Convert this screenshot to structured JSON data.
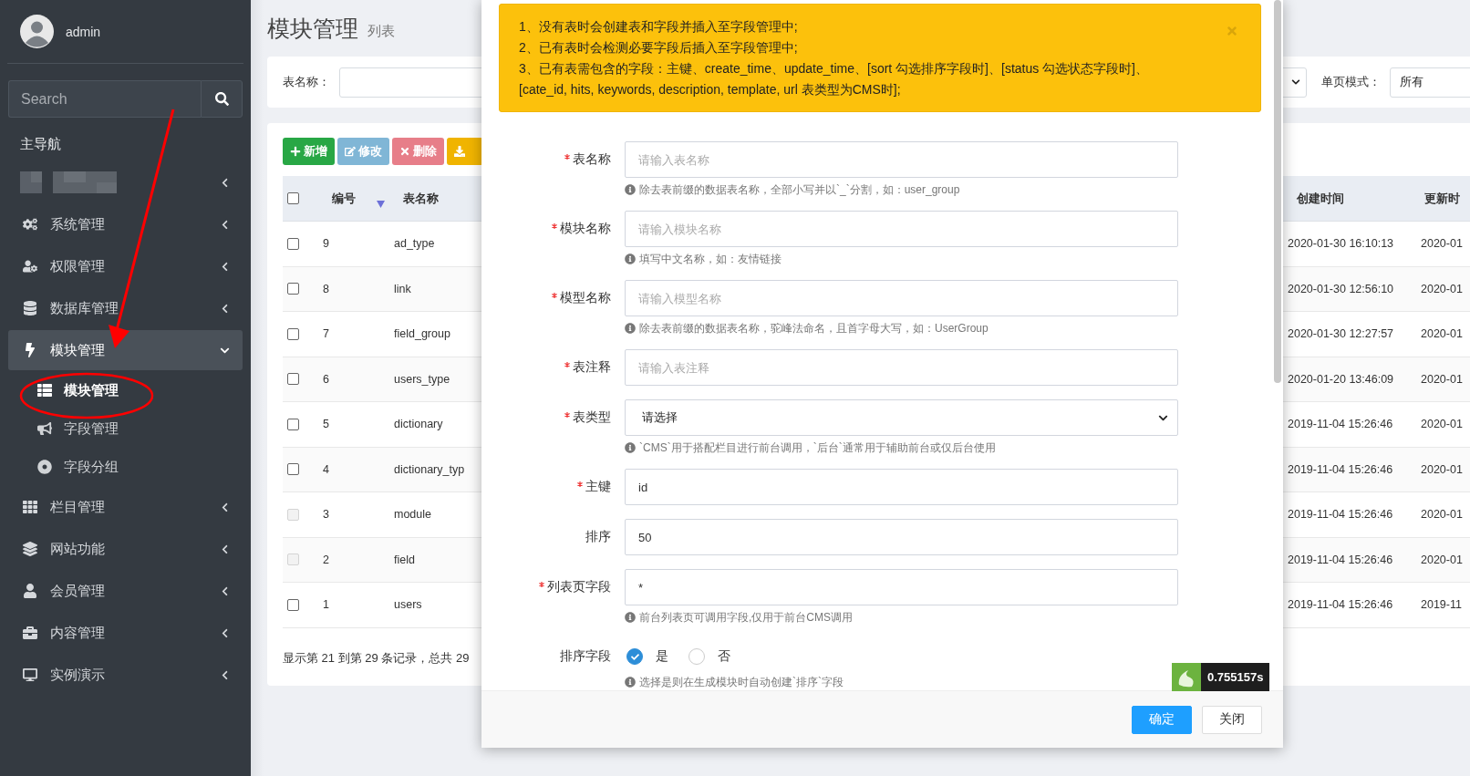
{
  "sidebar": {
    "user": {
      "name": "admin"
    },
    "search": {
      "placeholder": "Search"
    },
    "header": "主导航",
    "items": [
      {
        "kind": "blurred",
        "expanded": false,
        "selected": false
      },
      {
        "kind": "menu",
        "label": "系统管理",
        "expanded": false,
        "selected": false
      },
      {
        "kind": "menu",
        "label": "权限管理",
        "expanded": false,
        "selected": false
      },
      {
        "kind": "menu",
        "label": "数据库管理",
        "expanded": false,
        "selected": false
      },
      {
        "kind": "menu",
        "label": "模块管理",
        "expanded": true,
        "selected": true,
        "children": [
          {
            "label": "模块管理",
            "selected": true
          },
          {
            "label": "字段管理",
            "selected": false
          },
          {
            "label": "字段分组",
            "selected": false
          }
        ]
      },
      {
        "kind": "menu",
        "label": "栏目管理",
        "expanded": false,
        "selected": false
      },
      {
        "kind": "menu",
        "label": "网站功能",
        "expanded": false,
        "selected": false
      },
      {
        "kind": "menu",
        "label": "会员管理",
        "expanded": false,
        "selected": false
      },
      {
        "kind": "menu",
        "label": "内容管理",
        "expanded": false,
        "selected": false
      },
      {
        "kind": "menu",
        "label": "实例演示",
        "expanded": false,
        "selected": false
      }
    ]
  },
  "page": {
    "title": "模块管理",
    "subtitle": "列表"
  },
  "filter_bar": {
    "left": [
      {
        "kind": "text",
        "label": "表名称："
      }
    ],
    "right": [
      {
        "kind": "select"
      },
      {
        "kind": "text",
        "label": "单页模式：",
        "value": "所有"
      }
    ]
  },
  "toolbar": [
    {
      "kind": "add",
      "label": "新增"
    },
    {
      "kind": "edit",
      "label": "修改"
    },
    {
      "kind": "delete",
      "label": "删除"
    },
    {
      "kind": "export"
    }
  ],
  "table": {
    "header_checked": false,
    "columns": [
      {
        "label": "编号",
        "sorted": true
      },
      {
        "label": "表名称",
        "sorted": false
      },
      {
        "label": "创建时间",
        "sorted": false
      },
      {
        "label": "更新时",
        "sorted": false
      }
    ],
    "rows": [
      {
        "checked": false,
        "disabled": false,
        "id": "9",
        "name": "ad_type",
        "created": "2020-01-30 16:10:13",
        "updated": "2020-01"
      },
      {
        "checked": false,
        "disabled": false,
        "id": "8",
        "name": "link",
        "created": "2020-01-30 12:56:10",
        "updated": "2020-01"
      },
      {
        "checked": false,
        "disabled": false,
        "id": "7",
        "name": "field_group",
        "created": "2020-01-30 12:27:57",
        "updated": "2020-01"
      },
      {
        "checked": false,
        "disabled": false,
        "id": "6",
        "name": "users_type",
        "created": "2020-01-20 13:46:09",
        "updated": "2020-01"
      },
      {
        "checked": false,
        "disabled": false,
        "id": "5",
        "name": "dictionary",
        "created": "2019-11-04 15:26:46",
        "updated": "2020-01"
      },
      {
        "checked": false,
        "disabled": false,
        "id": "4",
        "name": "dictionary_typ",
        "created": "2019-11-04 15:26:46",
        "updated": "2020-01"
      },
      {
        "checked": false,
        "disabled": true,
        "id": "3",
        "name": "module",
        "created": "2019-11-04 15:26:46",
        "updated": "2020-01"
      },
      {
        "checked": false,
        "disabled": true,
        "id": "2",
        "name": "field",
        "created": "2019-11-04 15:26:46",
        "updated": "2020-01"
      },
      {
        "checked": false,
        "disabled": false,
        "id": "1",
        "name": "users",
        "created": "2019-11-04 15:26:46",
        "updated": "2019-11"
      }
    ],
    "footer": "显示第 21 到第 29 条记录，总共 29"
  },
  "modal": {
    "alert": [
      "1、没有表时会创建表和字段并插入至字段管理中;",
      "2、已有表时会检测必要字段后插入至字段管理中;",
      "3、已有表需包含的字段：主键、create_time、update_time、[sort 勾选排序字段时]、[status 勾选状态字段时]、",
      "[cate_id, hits, keywords, description, template, url 表类型为CMS时];"
    ],
    "fields": [
      {
        "kind": "input",
        "label": "表名称",
        "required": true,
        "placeholder": "请输入表名称",
        "hint": "除去表前缀的数据表名称，全部小写并以`_`分割，如：user_group"
      },
      {
        "kind": "input",
        "label": "模块名称",
        "required": true,
        "placeholder": "请输入模块名称",
        "hint": "填写中文名称，如：友情链接"
      },
      {
        "kind": "input",
        "label": "模型名称",
        "required": true,
        "placeholder": "请输入模型名称",
        "hint": "除去表前缀的数据表名称，驼峰法命名，且首字母大写，如：UserGroup"
      },
      {
        "kind": "input",
        "label": "表注释",
        "required": true,
        "placeholder": "请输入表注释"
      },
      {
        "kind": "select",
        "label": "表类型",
        "required": true,
        "value": "请选择",
        "hint": "`CMS`用于搭配栏目进行前台调用，`后台`通常用于辅助前台或仅后台使用"
      },
      {
        "kind": "input",
        "label": "主键",
        "required": true,
        "value": "id"
      },
      {
        "kind": "input",
        "label": "排序",
        "required": false,
        "value": "50"
      },
      {
        "kind": "input",
        "label": "列表页字段",
        "required": true,
        "value": "*",
        "hint": "前台列表页可调用字段,仅用于前台CMS调用"
      },
      {
        "kind": "radio",
        "label": "排序字段",
        "required": false,
        "options": [
          {
            "label": "是",
            "selected": true
          },
          {
            "label": "否",
            "selected": false
          }
        ],
        "hint": "选择是则在生成模块时自动创建`排序`字段"
      }
    ],
    "buttons": [
      {
        "kind": "primary",
        "label": "确定"
      },
      {
        "kind": "default",
        "label": "关闭"
      }
    ]
  },
  "timer": {
    "value": "0.755157s"
  }
}
